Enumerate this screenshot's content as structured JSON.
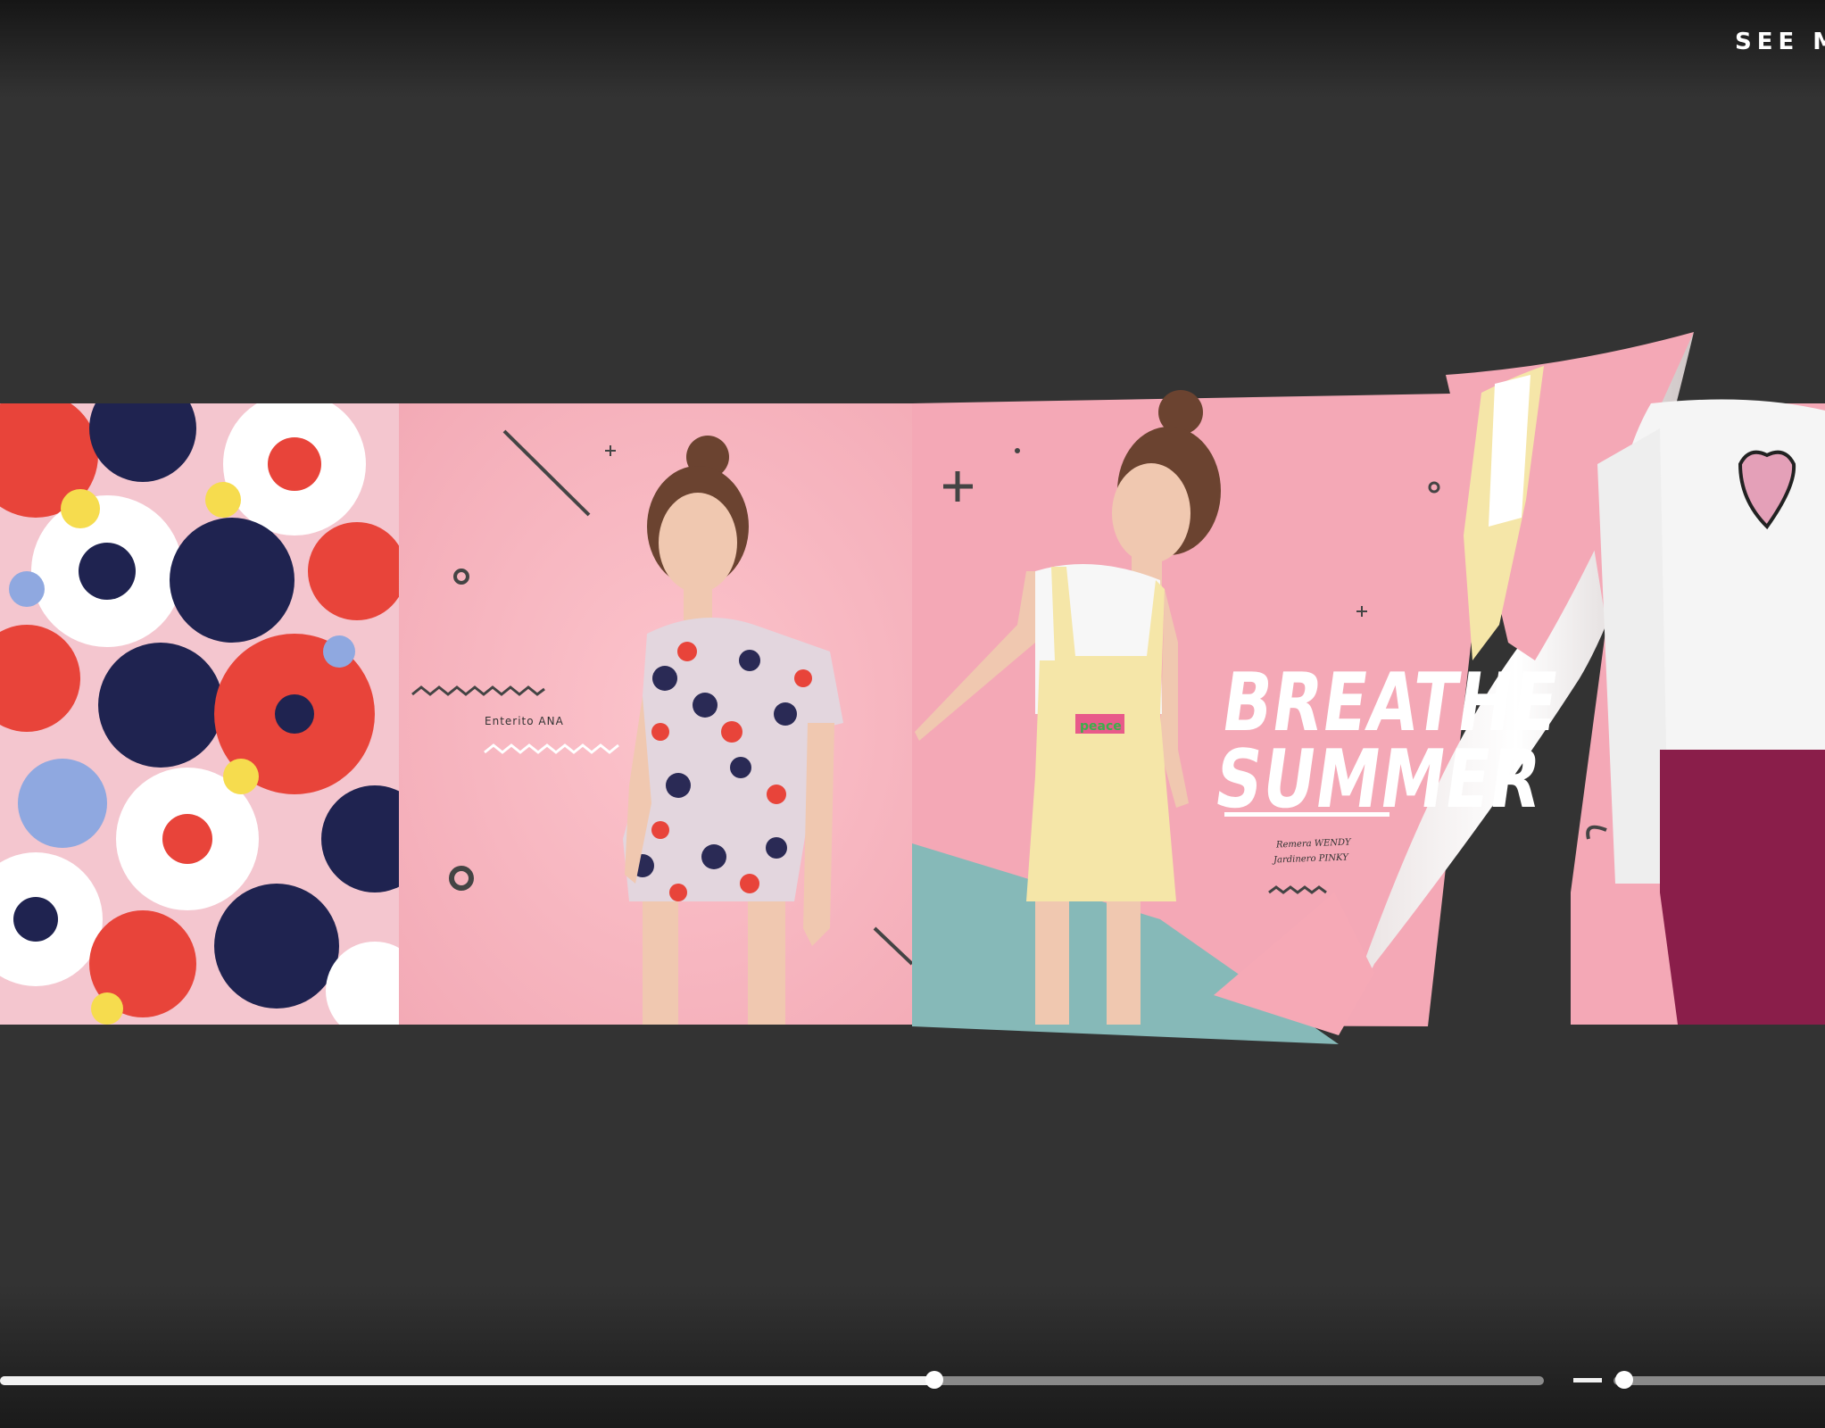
{
  "header": {
    "see_more_label": "SEE MO"
  },
  "spread": {
    "left_page": {
      "caption": "Enterito ANA"
    },
    "right_page": {
      "headline_line1": "BREATHE",
      "headline_line2": "SUMMER",
      "caption_line1": "Remera WENDY",
      "caption_line2": "Jardinero PINKY"
    }
  },
  "navigation": {
    "progress": 0.605
  },
  "zoom": {
    "level": 0.05
  },
  "colors": {
    "background": "#333333",
    "page_pink": "#f7b6c0",
    "teal": "#8fbcbc"
  }
}
